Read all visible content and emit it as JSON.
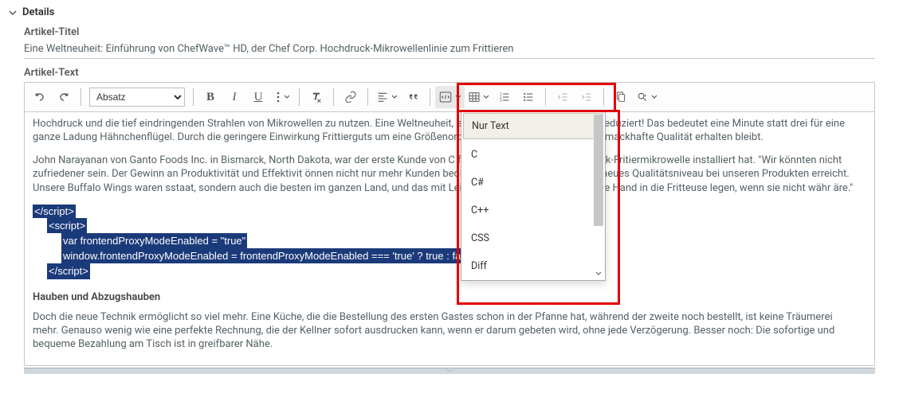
{
  "section_title": "Details",
  "fields": {
    "title_label": "Artikel-Titel",
    "title_value": "Eine Weltneuheit: Einführung von ChefWave™ HD, der Chef Corp. Hochdruck-Mikrowellenlinie zum Frittieren",
    "body_label": "Artikel-Text"
  },
  "toolbar": {
    "paragraph_select": "Absatz"
  },
  "dropdown": {
    "items": [
      "Nur Text",
      "C",
      "C#",
      "C++",
      "CSS",
      "Diff"
    ]
  },
  "body": {
    "p1": "Hochdruck und die tief eindringenden Strahlen von Mikrowellen zu nutzen. Eine Weltneuheit,                                                                 en von Geflügel um zwei Drittel reduziert! Das bedeutet eine Minute statt drei für eine ganze Ladung Hähnchenflügel. Durch die geringere Einwirkung                                                                Frittierguts um eine Größenordnung gesenkt, während die schmackhafte Qualität erhalten bleibt.",
    "p2": "John Narayanan von Ganto Foods Inc. in Bismarck, North Dakota, war der erste Kunde von C                                                               fessional-Variante der Hochdruck-Fritiermikrowelle installiert hat. \"Wir könnten nicht zufriedener sein. Der Gewinn an Produktivität und Effektivit                                                               önnen nicht nur mehr Kunden bedienen, sondern haben auch ein neues Qualitätsniveau bei unseren Produkten erreicht. Unsere Buffalo Wings waren                                                                 sstaat, sondern auch die besten im ganzen Land, und das mit Leichtigkeit. Dafür würde ich meine Hand in die Fritteuse legen, wenn sie nicht währ                                                                äre.\"",
    "code_lines": [
      "</script​>",
      "<script​>",
      "var frontendProxyModeEnabled = \"true\"",
      "window.frontendProxyModeEnabled = frontendProxyModeEnabled === 'true' ? true : fals",
      "</script​>"
    ],
    "subhead": "Hauben und Abzugshauben",
    "p3": "Doch die neue Technik ermöglicht so viel mehr. Eine Küche, die die Bestellung des ersten Gastes schon in der Pfanne hat, während der zweite noch bestellt, ist keine Träumerei mehr. Genauso wenig wie eine perfekte Rechnung, die der Kellner sofort ausdrucken kann, wenn er darum gebeten wird, ohne jede Verzögerung. Besser noch: Die sofortige und bequeme Bezahlung am Tisch ist in greifbarer Nähe."
  }
}
